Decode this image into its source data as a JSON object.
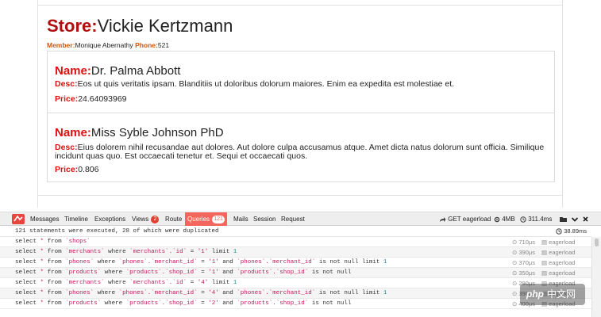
{
  "store": {
    "label": "Store:",
    "name": "Vickie Kertzmann"
  },
  "member": {
    "label": "Member:",
    "name": "Monique Abernathy",
    "phone_label": "Phone:",
    "phone": "521"
  },
  "products": [
    {
      "name_label": "Name:",
      "name": "Dr. Palma Abbott",
      "desc_label": "Desc:",
      "desc": "Eos ut quis veritatis ipsam. Blanditiis ut doloribus dolorum maiores. Enim ea expedita est molestiae et.",
      "price_label": "Price:",
      "price": "24.64093969"
    },
    {
      "name_label": "Name:",
      "name": "Miss Syble Johnson PhD",
      "desc_label": "Desc:",
      "desc": "Eius dolorem nihil recusandae aut dolores. Aut dolore culpa accusamus atque. Amet dicta natus dolorum sunt officia. Similique incidunt quas quo. Est occaecati tenetur et. Sequi et occaecati quos.",
      "price_label": "Price:",
      "price": "0.806"
    }
  ],
  "debugbar": {
    "tabs": {
      "messages": "Messages",
      "timeline": "Timeline",
      "exceptions": "Exceptions",
      "views": "Views",
      "views_count": "2",
      "route": "Route",
      "queries": "Queries",
      "queries_count": "121",
      "mails": "Mails",
      "session": "Session",
      "request": "Request"
    },
    "request": "GET eagerload",
    "memory": "4MB",
    "time": "311.4ms",
    "summary": "121 statements were executed, 28 of which were duplicated",
    "summary_duration": "38.89ms",
    "connection": "eagerload",
    "queries": [
      {
        "time": "710μs"
      },
      {
        "time": "390μs"
      },
      {
        "time": "370μs"
      },
      {
        "time": "350μs"
      },
      {
        "time": "290μs"
      },
      {
        "time": "390μs"
      },
      {
        "time": "400μs"
      }
    ],
    "sql": {
      "select": "select",
      "star": "*",
      "from": "from",
      "where": "where",
      "and": "and",
      "is_not_null": "is not null",
      "limit": "limit",
      "eq": "=",
      "t_shops": "`shops`",
      "t_merchants": "`merchants`",
      "t_phones": "`phones`",
      "t_products": "`products`",
      "c_merchants_id": "`merchants`.`id`",
      "c_phones_mid": "`phones`.`merchant_id`",
      "c_products_sid": "`products`.`shop_id`",
      "v1": "'1'",
      "v2": "'2'",
      "v4": "'4'",
      "n1": "1"
    }
  },
  "watermark": {
    "logo": "php",
    "text": "中文网"
  },
  "colors": {
    "store_label": "#b10e0e",
    "field_label": "#e01010",
    "member_label": "#d4550a",
    "active_tab": "#f4655d",
    "badge": "#e83b2d"
  }
}
